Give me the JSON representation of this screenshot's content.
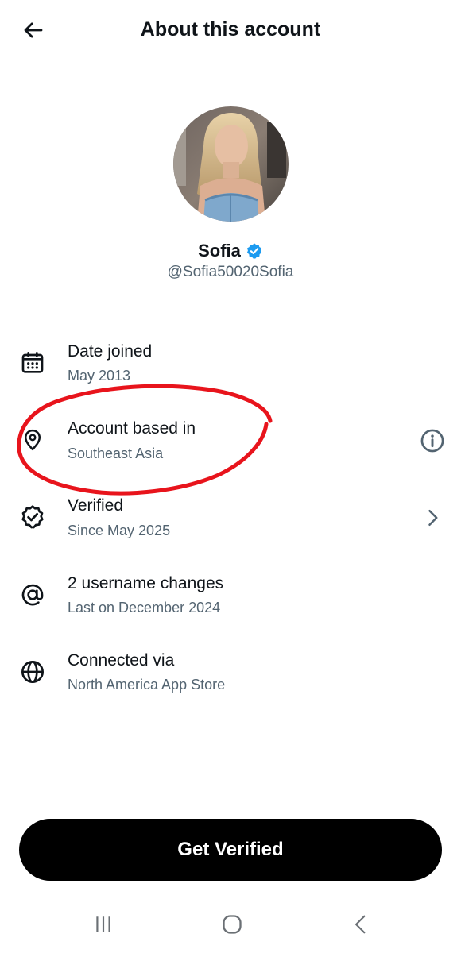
{
  "header": {
    "title": "About this account",
    "back_icon": "arrow-left-icon"
  },
  "profile": {
    "name": "Sofia",
    "handle": "@Sofia50020Sofia",
    "verified": true,
    "badge_color": "#1d9bf0"
  },
  "rows": [
    {
      "icon": "calendar-icon",
      "title": "Date joined",
      "subtitle": "May 2013"
    },
    {
      "icon": "location-pin-icon",
      "title": "Account based in",
      "subtitle": "Southeast Asia",
      "trailing_icon": "info-icon"
    },
    {
      "icon": "verified-badge-icon",
      "title": "Verified",
      "subtitle": "Since May 2025",
      "trailing_icon": "chevron-right-icon"
    },
    {
      "icon": "at-sign-icon",
      "title": "2 username changes",
      "subtitle": "Last on December 2024"
    },
    {
      "icon": "globe-icon",
      "title": "Connected via",
      "subtitle": "North America App Store"
    }
  ],
  "annotation": {
    "shape": "hand-drawn-ellipse",
    "color": "#e8141c",
    "target": "Account based in"
  },
  "cta": {
    "label": "Get Verified"
  },
  "system_nav": {
    "items": [
      "recent-apps-icon",
      "home-icon",
      "back-icon"
    ]
  },
  "colors": {
    "text": "#0f1419",
    "secondary_text": "#536471",
    "background": "#ffffff",
    "button": "#000000"
  }
}
